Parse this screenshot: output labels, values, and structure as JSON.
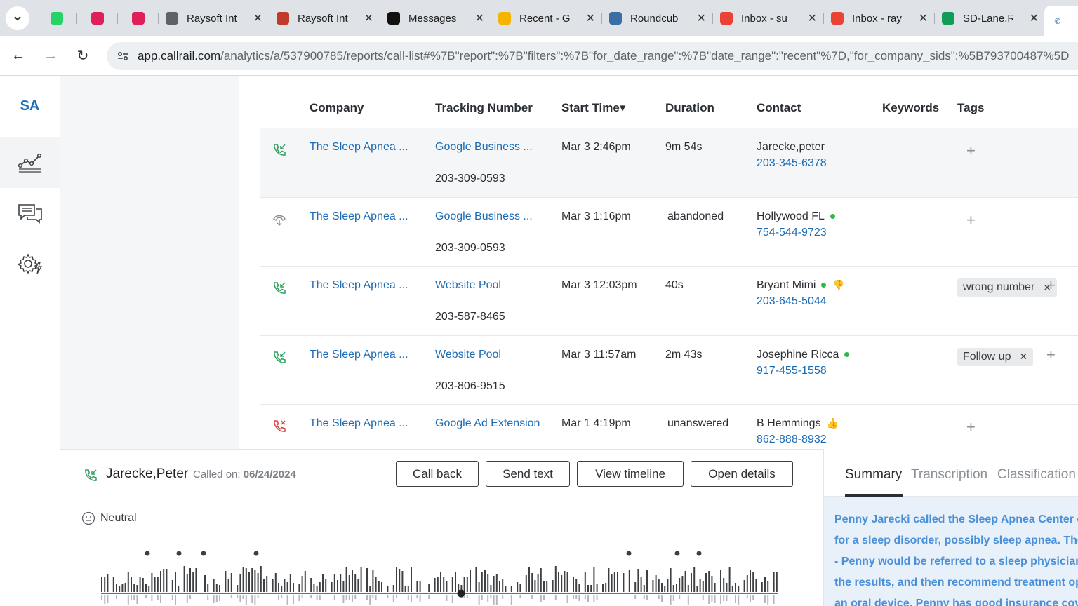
{
  "browser": {
    "tabs": [
      {
        "title": "",
        "icon": "whatsapp-icon",
        "color": "#25d366",
        "pinned": true
      },
      {
        "title": "",
        "icon": "slack-icon",
        "color": "#e01e5a",
        "pinned": true
      },
      {
        "title": "",
        "icon": "slack-icon",
        "color": "#e01e5a",
        "pinned": true
      },
      {
        "title": "Raysoft Int",
        "icon": "globe-icon",
        "color": "#5f6368"
      },
      {
        "title": "Raysoft Int",
        "icon": "raysoft-icon",
        "color": "#c0392b"
      },
      {
        "title": "Messages",
        "icon": "upwork-icon",
        "color": "#111111"
      },
      {
        "title": "Recent - G",
        "icon": "google-drive-icon",
        "color": "#f4b400"
      },
      {
        "title": "Roundcub",
        "icon": "roundcube-icon",
        "color": "#3a6ea5"
      },
      {
        "title": "Inbox - su",
        "icon": "gmail-icon",
        "color": "#ea4335"
      },
      {
        "title": "Inbox - ray",
        "icon": "gmail-icon",
        "color": "#ea4335"
      },
      {
        "title": "SD-Lane.R",
        "icon": "google-sheets-icon",
        "color": "#0f9d58"
      }
    ],
    "url_host": "app.callrail.com",
    "url_path": "/analytics/a/537900785/reports/call-list#%7B\"report\":%7B\"filters\":%7B\"for_date_range\":%7B\"date_range\":\"recent\"%7D,\"for_company_sids\":%5B793700487%5D"
  },
  "rail": {
    "logo": "SA",
    "items": [
      "analytics-icon",
      "conversations-icon",
      "settings-icon"
    ]
  },
  "table": {
    "headers": {
      "company": "Company",
      "tracking": "Tracking Number",
      "start_time": "Start Time▾",
      "duration": "Duration",
      "contact": "Contact",
      "keywords": "Keywords",
      "tags": "Tags"
    },
    "rows": [
      {
        "status": "answered",
        "company": "The Sleep Apnea ...",
        "source": "Google Business ...",
        "number": "203-309-0593",
        "time": "Mar 3 2:46pm",
        "duration": "9m 54s",
        "duration_status": false,
        "contact": "Jarecke,peter",
        "contact_dot": false,
        "phone": "203-345-6378",
        "tags": [],
        "thumb": ""
      },
      {
        "status": "abandoned",
        "company": "The Sleep Apnea ...",
        "source": "Google Business ...",
        "number": "203-309-0593",
        "time": "Mar 3 1:16pm",
        "duration": "abandoned",
        "duration_status": true,
        "contact": "Hollywood FL",
        "contact_dot": true,
        "phone": "754-544-9723",
        "tags": [],
        "thumb": ""
      },
      {
        "status": "answered",
        "company": "The Sleep Apnea ...",
        "source": "Website Pool",
        "number": "203-587-8465",
        "time": "Mar 3 12:03pm",
        "duration": "40s",
        "duration_status": false,
        "contact": "Bryant Mimi",
        "contact_dot": true,
        "phone": "203-645-5044",
        "tags": [
          "wrong number"
        ],
        "thumb": "down"
      },
      {
        "status": "answered",
        "company": "The Sleep Apnea ...",
        "source": "Website Pool",
        "number": "203-806-9515",
        "time": "Mar 3 11:57am",
        "duration": "2m 43s",
        "duration_status": false,
        "contact": "Josephine Ricca",
        "contact_dot": true,
        "phone": "917-455-1558",
        "tags": [
          "Follow up"
        ],
        "thumb": ""
      },
      {
        "status": "missed",
        "company": "The Sleep Apnea ...",
        "source": "Google Ad Extension",
        "number": "",
        "time": "Mar 1 4:19pm",
        "duration": "unanswered",
        "duration_status": true,
        "contact": "B Hemmings",
        "contact_dot": false,
        "phone": "862-888-8932",
        "tags": [],
        "thumb": "up"
      }
    ]
  },
  "detail": {
    "caller": "Jarecke,Peter",
    "called_on_label": "Called on:",
    "called_on_date": "06/24/2024",
    "buttons": [
      "Call back",
      "Send text",
      "View timeline",
      "Open details"
    ],
    "sentiment": "Neutral"
  },
  "side": {
    "tabs": [
      "Summary",
      "Transcription",
      "Classification"
    ],
    "summary_lines": [
      "Penny Jarecki called the Sleep Apnea Center of",
      "for a sleep disorder, possibly sleep apnea. The",
      "- Penny would be referred to a sleep physician",
      "the results, and then recommend treatment op",
      "an oral device. Penny has good insurance cove"
    ]
  },
  "colors": {
    "link": "#1c6bb5",
    "summary": "#4a90d9",
    "answered": "#2e9e5b",
    "missed": "#d9423a"
  }
}
